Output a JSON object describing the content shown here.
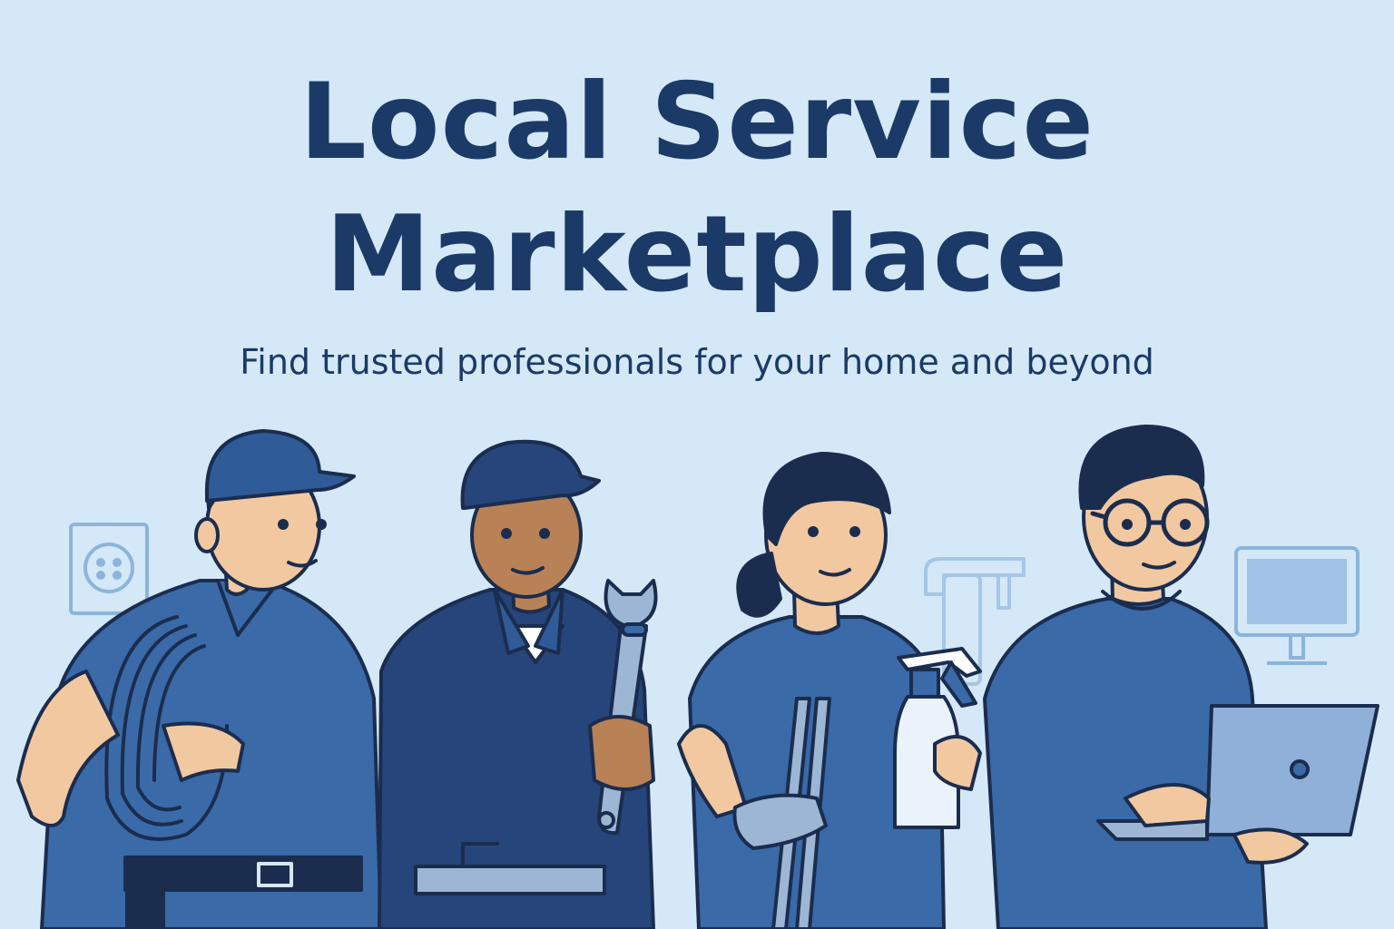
{
  "hero": {
    "title_line1": "Local Service",
    "title_line2": "Marketplace",
    "subtitle": "Find trusted professionals for your home and beyond"
  },
  "illustration": {
    "workers": [
      {
        "role": "electrician",
        "props": [
          "cable-coil-icon",
          "tool-belt-icon"
        ]
      },
      {
        "role": "plumber",
        "props": [
          "wrench-icon",
          "tool-belt-icon"
        ]
      },
      {
        "role": "cleaner",
        "props": [
          "spray-bottle-icon",
          "mop-icon",
          "glove-icon"
        ]
      },
      {
        "role": "it-technician",
        "props": [
          "laptop-icon",
          "glasses-icon"
        ]
      }
    ],
    "background_icons": [
      "power-outlet-icon",
      "faucet-icon",
      "monitor-icon"
    ]
  },
  "colors": {
    "background": "#d4e8f8",
    "title": "#1b3a67",
    "uniform_light": "#3a6aa8",
    "uniform_dark": "#26457a",
    "outline": "#1b2d4f",
    "skin_light": "#f2c8a0",
    "skin_dark": "#b98156",
    "icon_outline": "#8cb4dc"
  }
}
